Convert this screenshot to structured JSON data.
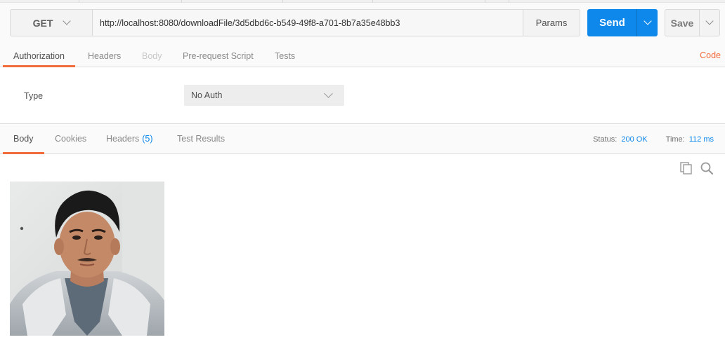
{
  "request": {
    "method": "GET",
    "url": "http://localhost:8080/downloadFile/3d5dbd6c-b549-49f8-a701-8b7a35e48bb3",
    "params_label": "Params",
    "send_label": "Send",
    "save_label": "Save"
  },
  "request_tabs": {
    "authorization": "Authorization",
    "headers": "Headers",
    "body": "Body",
    "prerequest": "Pre-request Script",
    "tests": "Tests",
    "code_link": "Code"
  },
  "auth": {
    "type_label": "Type",
    "selected": "No Auth"
  },
  "response_tabs": {
    "body": "Body",
    "cookies": "Cookies",
    "headers": "Headers",
    "headers_count": "(5)",
    "test_results": "Test Results"
  },
  "response_meta": {
    "status_label": "Status:",
    "status_value": "200 OK",
    "time_label": "Time:",
    "time_value": "112 ms"
  },
  "icons": {
    "copy": "copy-icon",
    "search": "search-icon",
    "dropdown": "chevron-down-icon"
  },
  "colors": {
    "accent_orange": "#f26b3a",
    "send_blue": "#0e88ea"
  }
}
